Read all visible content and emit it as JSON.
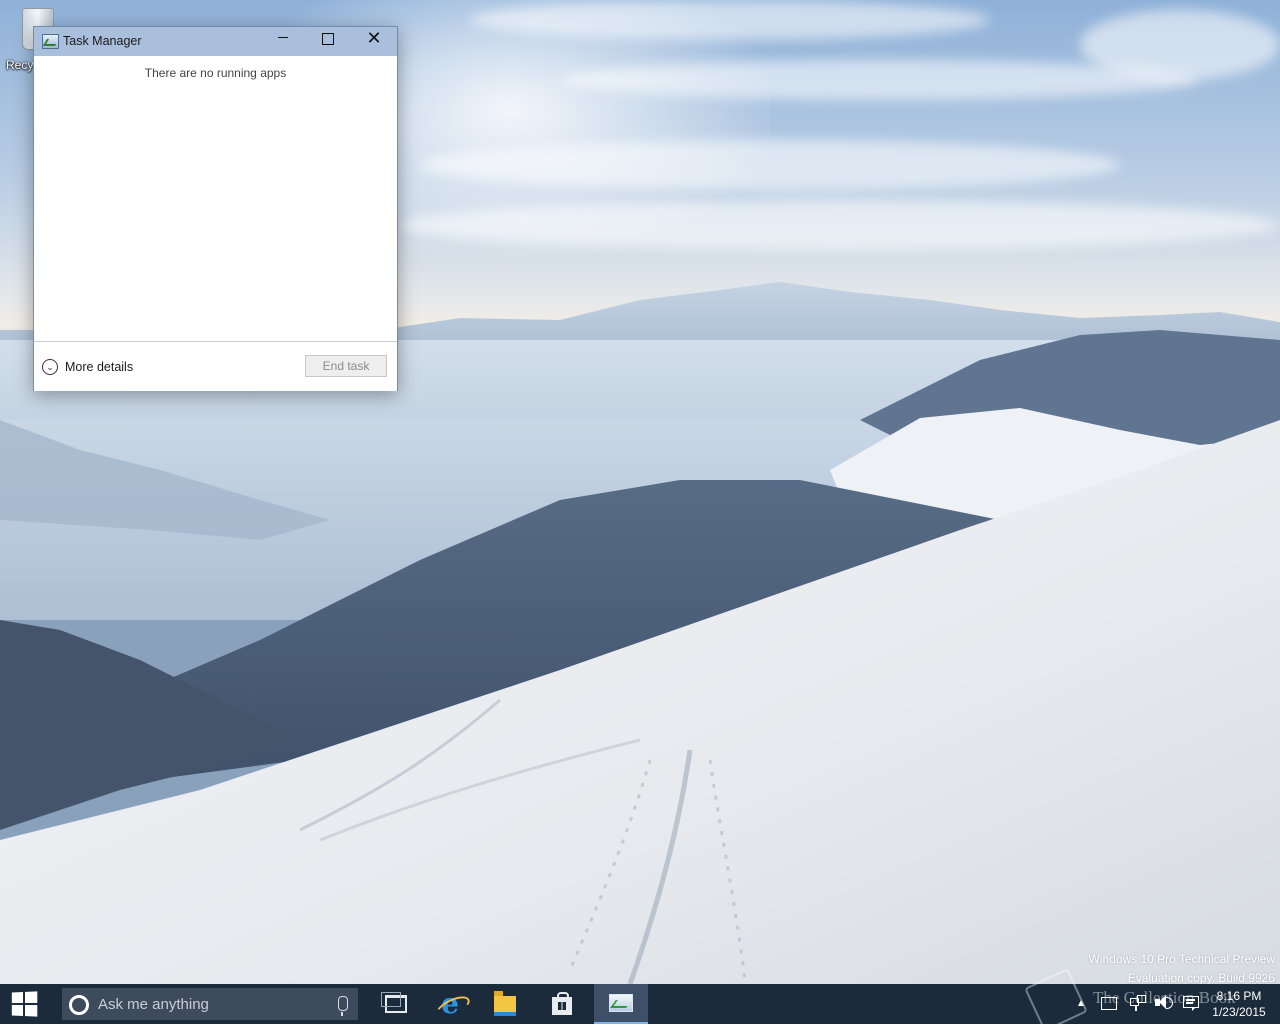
{
  "desktop": {
    "icons": [
      {
        "label": "Recy",
        "icon": "recycle-bin-icon"
      }
    ],
    "watermark": {
      "line1": "Windows 10 Pro Technical Preview",
      "line2": "Evaluation copy. Build 9926"
    }
  },
  "task_manager": {
    "title": "Task Manager",
    "app_icon": "task-manager-icon",
    "message": "There are no running apps",
    "more_details_label": "More details",
    "end_task_label": "End task",
    "controls": {
      "minimize": "minimize-icon",
      "maximize": "maximize-icon",
      "close": "close-icon"
    }
  },
  "taskbar": {
    "search_placeholder": "Ask me anything",
    "pinned": [
      "task-view-icon",
      "internet-explorer-icon",
      "file-explorer-icon",
      "store-icon",
      "task-manager-icon"
    ],
    "overlay_text": "The Collection Book",
    "tray": {
      "time": "8:16 PM",
      "date": "1/23/2015"
    },
    "colors": {
      "taskbar_bg": "#1c2b3c",
      "search_bg": "#3d4b5c",
      "titlebar": "#a9bfdc"
    }
  }
}
